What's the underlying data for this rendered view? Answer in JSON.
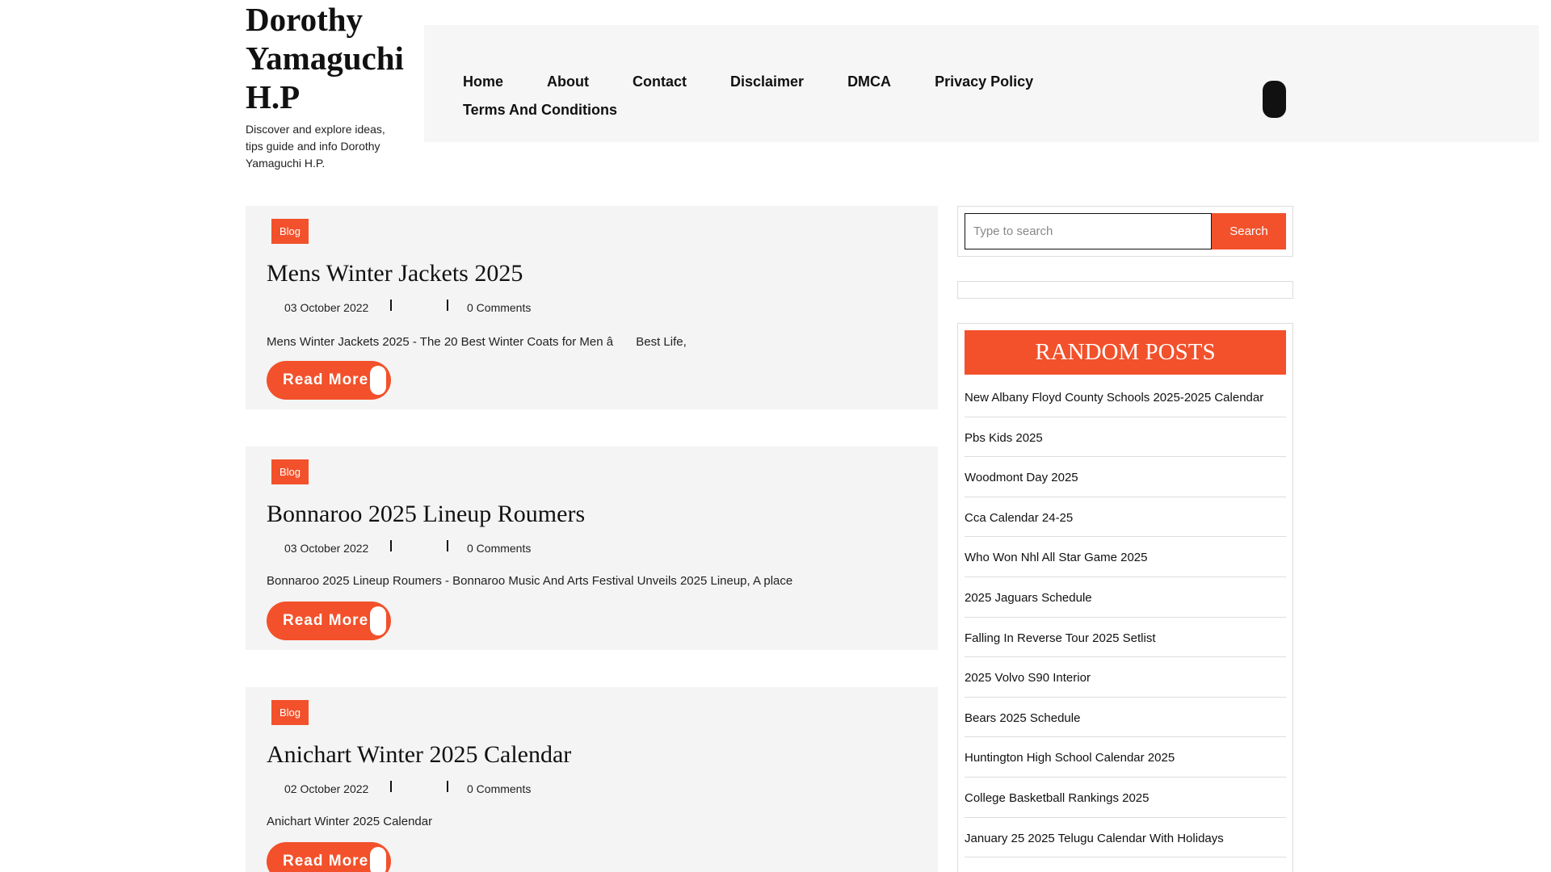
{
  "site": {
    "title": "Dorothy Yamaguchi H.P",
    "description": "Discover and explore ideas, tips guide and info Dorothy Yamaguchi H.P."
  },
  "nav": {
    "items": [
      "Home",
      "About",
      "Contact",
      "Disclaimer",
      "DMCA",
      "Privacy Policy",
      "Terms And Conditions"
    ],
    "toggle_icon": "menu-toggle-icon"
  },
  "posts": [
    {
      "category": "Blog",
      "title": "Mens Winter Jackets 2025",
      "date": "03 October 2022",
      "comments": "0 Comments",
      "excerpt": "Mens Winter Jackets 2025 - The 20 Best Winter Coats for Men â Best Life,",
      "read_more": "Read More"
    },
    {
      "category": "Blog",
      "title": "Bonnaroo 2025 Lineup Roumers",
      "date": "03 October 2022",
      "comments": "0 Comments",
      "excerpt": "Bonnaroo 2025 Lineup Roumers - Bonnaroo Music And Arts Festival Unveils 2025 Lineup, A place",
      "read_more": "Read More"
    },
    {
      "category": "Blog",
      "title": "Anichart Winter 2025 Calendar",
      "date": "02 October 2022",
      "comments": "0 Comments",
      "excerpt": "Anichart Winter 2025 Calendar",
      "read_more": "Read More"
    }
  ],
  "search": {
    "placeholder": "Type to search",
    "button": "Search"
  },
  "random_posts": {
    "heading": "RANDOM POSTS",
    "items": [
      "New Albany Floyd County Schools 2025-2025 Calendar",
      "Pbs Kids 2025",
      "Woodmont Day 2025",
      "Cca Calendar 24-25",
      "Who Won Nhl All Star Game 2025",
      "2025 Jaguars Schedule",
      "Falling In Reverse Tour 2025 Setlist",
      "2025 Volvo S90 Interior",
      "Bears 2025 Schedule",
      "Huntington High School Calendar 2025",
      "College Basketball Rankings 2025",
      "January 25 2025 Telugu Calendar With Holidays"
    ]
  },
  "colors": {
    "accent": "#f2512b",
    "nav_background": "#f6f6f6",
    "post_background": "#f4f4f4"
  }
}
